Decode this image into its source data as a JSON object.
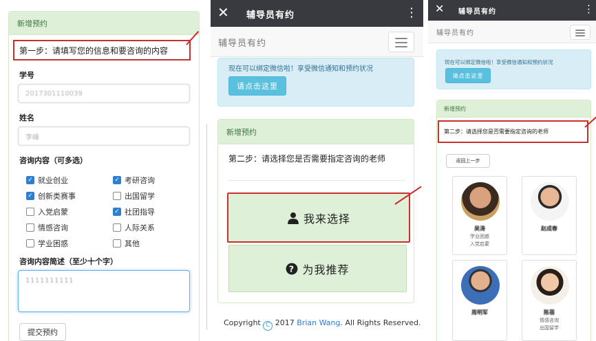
{
  "screen1": {
    "panel_heading": "新增预约",
    "step_text": "第一步：请填写您的信息和要咨询的内容",
    "student_id_label": "学号",
    "student_id_value": "2017301110039",
    "name_label": "姓名",
    "name_value": "李峰",
    "topics_label": "咨询内容（可多选）",
    "topics": [
      {
        "label": "就业创业",
        "checked": true
      },
      {
        "label": "考研咨询",
        "checked": true
      },
      {
        "label": "创新类赛事",
        "checked": true
      },
      {
        "label": "出国留学",
        "checked": false
      },
      {
        "label": "入党启蒙",
        "checked": false
      },
      {
        "label": "社团指导",
        "checked": true
      },
      {
        "label": "情感咨询",
        "checked": false
      },
      {
        "label": "人际关系",
        "checked": false
      },
      {
        "label": "学业困惑",
        "checked": false
      },
      {
        "label": "其他",
        "checked": false
      }
    ],
    "brief_label": "咨询内容简述（至少十个字）",
    "brief_value": "1111111111",
    "submit_label": "提交预约"
  },
  "screen2": {
    "titlebar": {
      "close_icon": "close-icon",
      "title": "辅导员有约",
      "more_icon": "more-vertical-icon"
    },
    "brand": "辅导员有约",
    "alert_text": "现在可以绑定微信啦！享受微信通知和预约状况",
    "alert_button": "请点击这里",
    "panel_heading": "新增预约",
    "step_text": "第二步：请选择您是否需要指定咨询的老师",
    "choose_button": "我来选择",
    "choose_icon": "user-icon",
    "recommend_button": "为我推荐",
    "recommend_icon": "question-circle-icon",
    "copyright_prefix": "Copyright",
    "copyright_year": "2017",
    "copyright_author": "Brian Wang",
    "copyright_suffix": ". All Rights Reserved."
  },
  "screen3": {
    "titlebar": {
      "close_icon": "close-icon",
      "title": "辅导员有约",
      "more_icon": "more-vertical-icon"
    },
    "brand": "辅导员有约",
    "alert_text": "现在可以绑定微信啦！享受微信通知和预约状况",
    "alert_button": "请点击这里",
    "panel_heading": "新增预约",
    "step_text": "第二步：请选择您是否需要指定咨询的老师",
    "back_button": "返回上一步",
    "teachers": [
      {
        "name": "吴涛",
        "tags": [
          "学业困惑",
          "入党启蒙"
        ]
      },
      {
        "name": "赵成春",
        "tags": []
      },
      {
        "name": "周明军",
        "tags": []
      },
      {
        "name": "陈蓓",
        "tags": [
          "情感咨询",
          "出国留学"
        ]
      }
    ]
  },
  "colors": {
    "panel_success_bg": "#dff0d8",
    "panel_success_border": "#d6e9c6",
    "alert_info_bg": "#d9edf7",
    "button_info": "#5bc0de",
    "annotation_red": "#d0262a",
    "titlebar_dark": "#393a3f",
    "checkbox_blue": "#2f7fd0"
  }
}
